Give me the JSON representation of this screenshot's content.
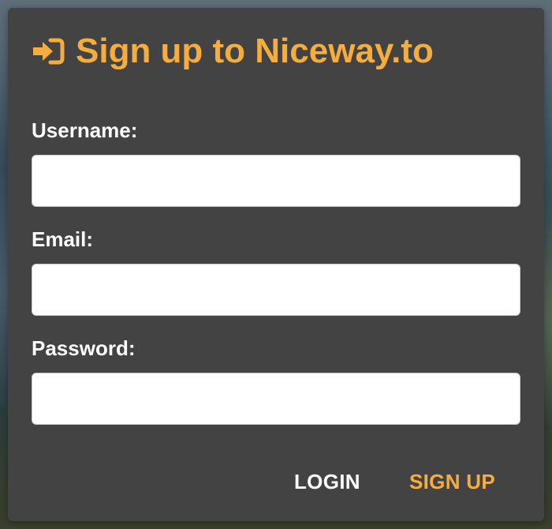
{
  "dialog": {
    "title": "Sign up to Niceway.to",
    "title_icon": "sign-in-icon",
    "accent_color": "#f5ad3e",
    "background_color": "#434343"
  },
  "form": {
    "username": {
      "label": "Username:",
      "value": "",
      "placeholder": ""
    },
    "email": {
      "label": "Email:",
      "value": "",
      "placeholder": ""
    },
    "password": {
      "label": "Password:",
      "value": "",
      "placeholder": ""
    }
  },
  "actions": {
    "login_label": "LOGIN",
    "signup_label": "SIGN UP"
  }
}
